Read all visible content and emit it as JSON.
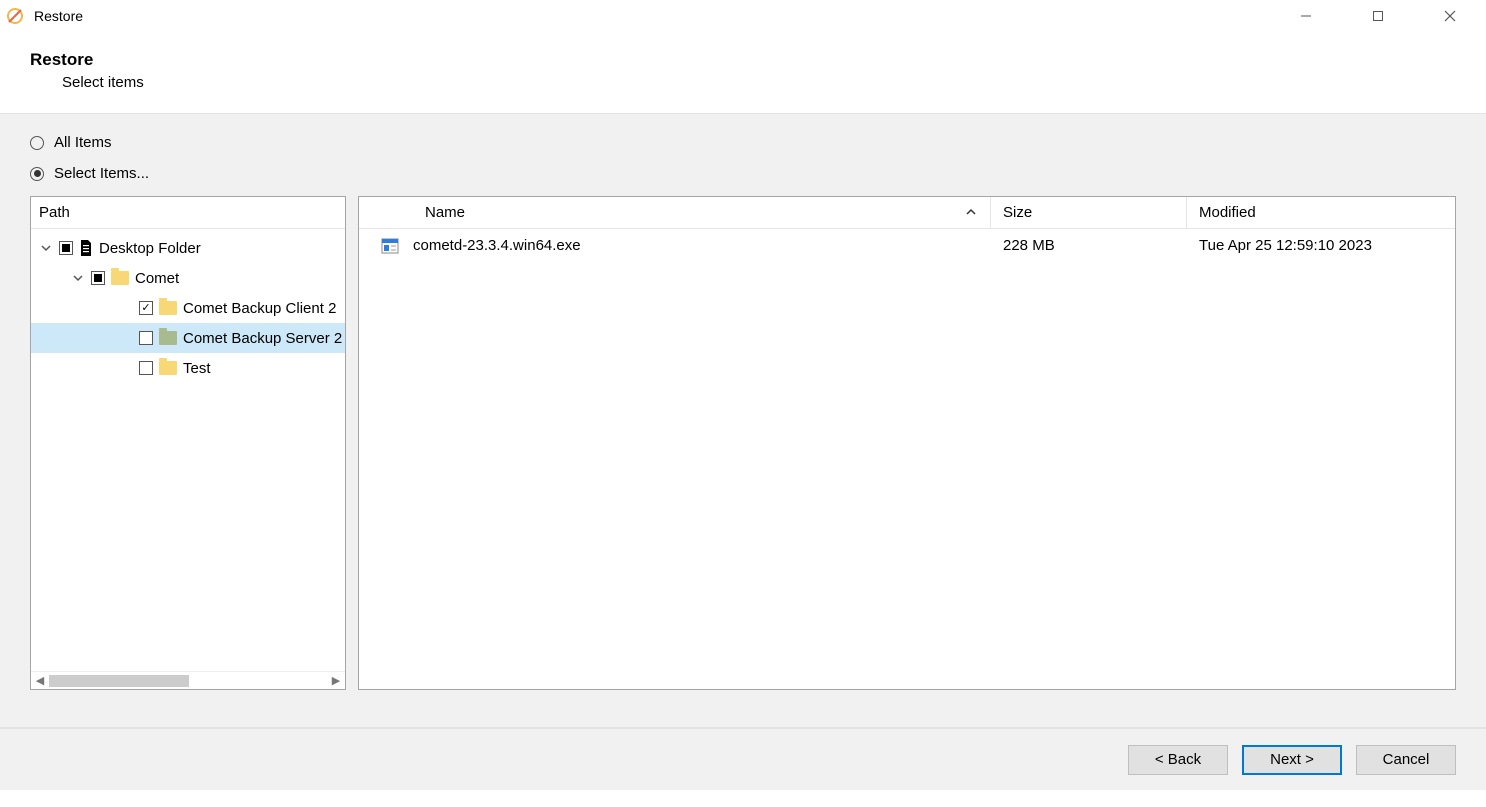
{
  "window": {
    "title": "Restore"
  },
  "header": {
    "title": "Restore",
    "subtitle": "Select items"
  },
  "radio": {
    "all": "All Items",
    "select": "Select Items..."
  },
  "tree": {
    "header": "Path",
    "root": {
      "label": "Desktop Folder"
    },
    "comet": {
      "label": "Comet"
    },
    "client": {
      "label": "Comet Backup Client 2"
    },
    "server": {
      "label": "Comet Backup Server 2"
    },
    "test": {
      "label": "Test"
    }
  },
  "list": {
    "headers": {
      "name": "Name",
      "size": "Size",
      "modified": "Modified"
    },
    "row0": {
      "name": "cometd-23.3.4.win64.exe",
      "size": "228 MB",
      "modified": "Tue Apr 25 12:59:10 2023"
    }
  },
  "buttons": {
    "back": "< Back",
    "next": "Next >",
    "cancel": "Cancel"
  }
}
